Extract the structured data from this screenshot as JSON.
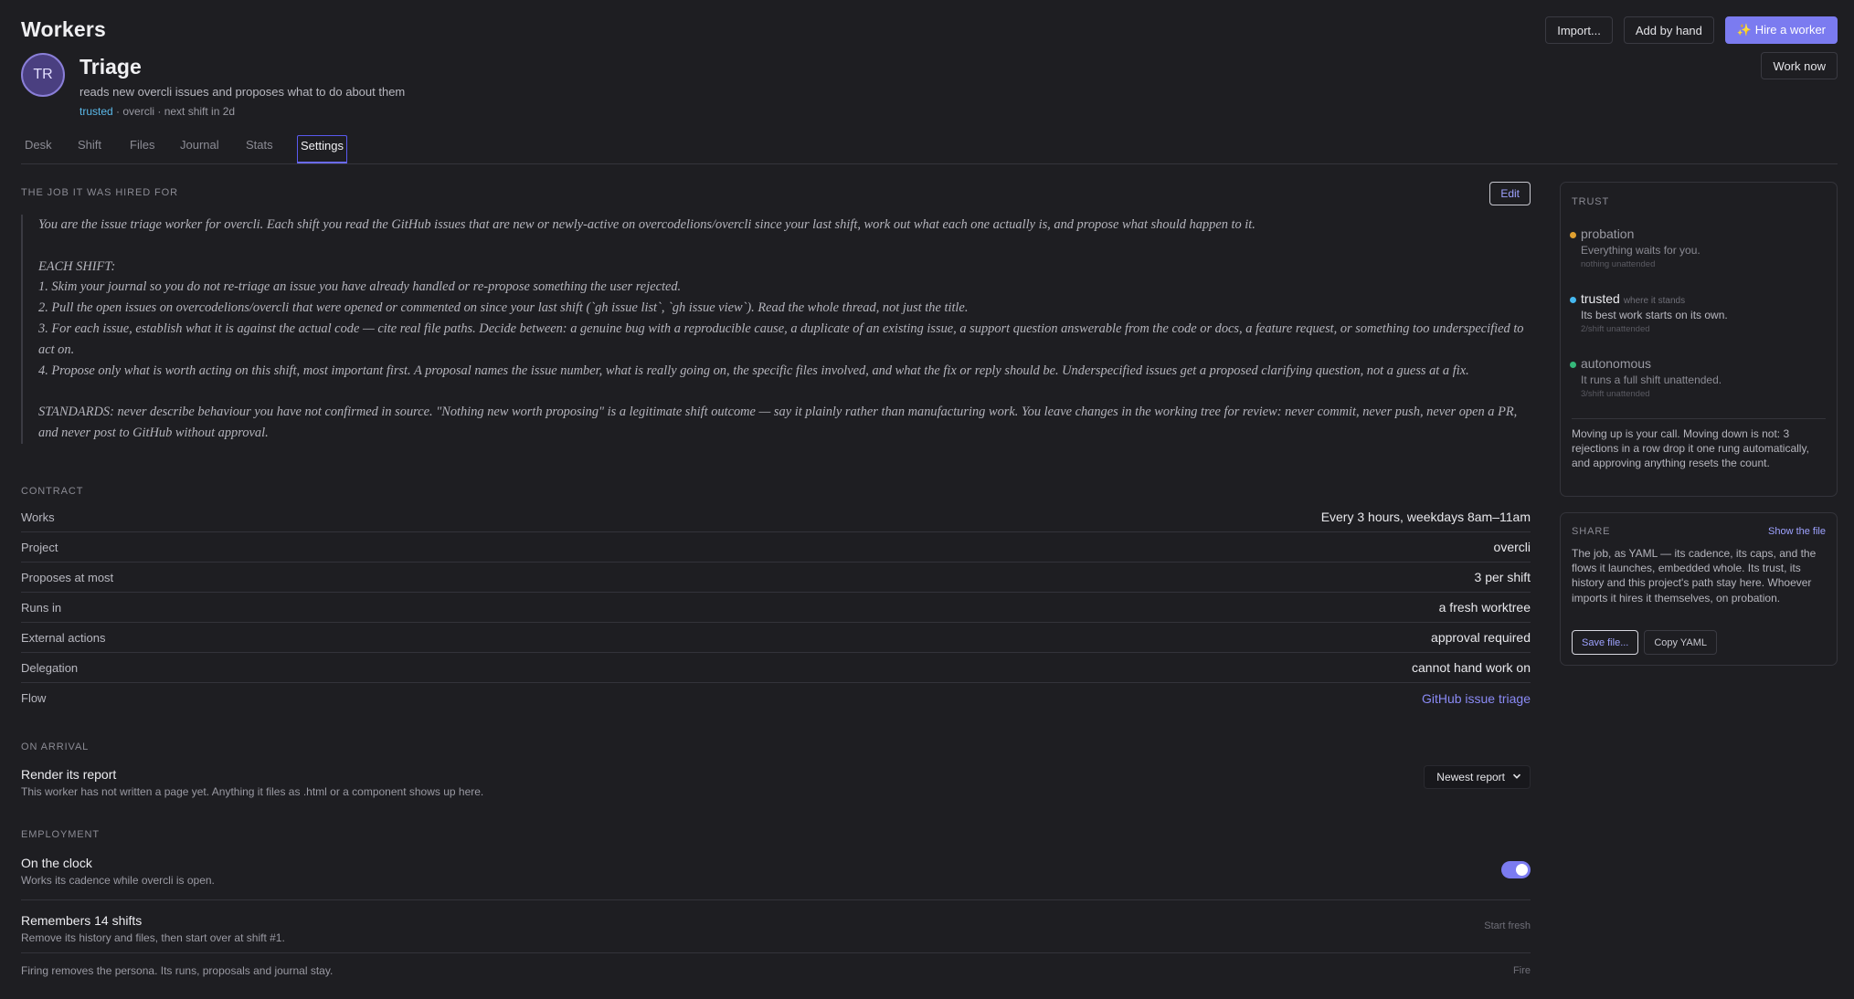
{
  "page": {
    "title": "Workers"
  },
  "top_actions": {
    "import_label": "Import...",
    "add_label": "Add by hand",
    "hire_label": "✨ Hire a worker",
    "work_now_label": "Work now"
  },
  "worker": {
    "initials": "TR",
    "name": "Triage",
    "description": "reads new overcli issues and proposes what to do about them",
    "trust_level": "trusted",
    "meta_rest": " · overcli · next shift in 2d"
  },
  "tabs": [
    "Desk",
    "Shift",
    "Files",
    "Journal",
    "Stats",
    "Settings"
  ],
  "job": {
    "section_label": "THE JOB IT WAS HIRED FOR",
    "edit_label": "Edit",
    "paragraphs": [
      "You are the issue triage worker for overcli. Each shift you read the GitHub issues that are new or newly-active on overcodelions/overcli since your last shift, work out what each one actually is, and propose what should happen to it.",
      "EACH SHIFT:\n1. Skim your journal so you do not re-triage an issue you have already handled or re-propose something the user rejected.\n2. Pull the open issues on overcodelions/overcli that were opened or commented on since your last shift (`gh issue list`, `gh issue view`). Read the whole thread, not just the title.\n3. For each issue, establish what it is against the actual code — cite real file paths. Decide between: a genuine bug with a reproducible cause, a duplicate of an existing issue, a support question answerable from the code or docs, a feature request, or something too underspecified to act on.\n4. Propose only what is worth acting on this shift, most important first. A proposal names the issue number, what is really going on, the specific files involved, and what the fix or reply should be. Underspecified issues get a proposed clarifying question, not a guess at a fix.",
      "STANDARDS: never describe behaviour you have not confirmed in source. \"Nothing new worth proposing\" is a legitimate shift outcome — say it plainly rather than manufacturing work. You leave changes in the working tree for review: never commit, never push, never open a PR, and never post to GitHub without approval."
    ]
  },
  "contract": {
    "section_label": "CONTRACT",
    "rows": [
      {
        "key": "Works",
        "value": "Every 3 hours, weekdays 8am–11am"
      },
      {
        "key": "Project",
        "value": "overcli"
      },
      {
        "key": "Proposes at most",
        "value": "3 per shift"
      },
      {
        "key": "Runs in",
        "value": "a fresh worktree"
      },
      {
        "key": "External actions",
        "value": "approval required"
      },
      {
        "key": "Delegation",
        "value": "cannot hand work on"
      },
      {
        "key": "Flow",
        "value": "GitHub issue triage"
      }
    ]
  },
  "arrival": {
    "section_label": "ON ARRIVAL",
    "title": "Render its report",
    "subtitle": "This worker has not written a page yet. Anything it files as .html or a component shows up here.",
    "select_value": "Newest report"
  },
  "employment": {
    "section_label": "EMPLOYMENT",
    "clock_title": "On the clock",
    "clock_sub": "Works its cadence while overcli is open.",
    "clock_on": true,
    "memory_title": "Remembers 14 shifts",
    "memory_sub": "Remove its history and files, then start over at shift #1.",
    "memory_action": "Start fresh",
    "fire_text": "Firing removes the persona. Its runs, proposals and journal stay.",
    "fire_action": "Fire"
  },
  "trust": {
    "section_label": "TRUST",
    "tiers": [
      {
        "name": "probation",
        "where": "",
        "desc": "Everything waits for you.",
        "small": "nothing unattended",
        "color": "#e0a030"
      },
      {
        "name": "trusted",
        "where": "where it stands",
        "desc": "Its best work starts on its own.",
        "small": "2/shift unattended",
        "color": "#45b8f0"
      },
      {
        "name": "autonomous",
        "where": "",
        "desc": "It runs a full shift unattended.",
        "small": "3/shift unattended",
        "color": "#35b87a"
      }
    ],
    "note": "Moving up is your call. Moving down is not: 3 rejections in a row drop it one rung automatically, and approving anything resets the count."
  },
  "share": {
    "section_label": "SHARE",
    "show_file_label": "Show the file",
    "text": "The job, as YAML — its cadence, its caps, and the flows it launches, embedded whole. Its trust, its history and this project's path stay here. Whoever imports it hires it themselves, on probation.",
    "save_label": "Save file...",
    "copy_label": "Copy YAML"
  }
}
